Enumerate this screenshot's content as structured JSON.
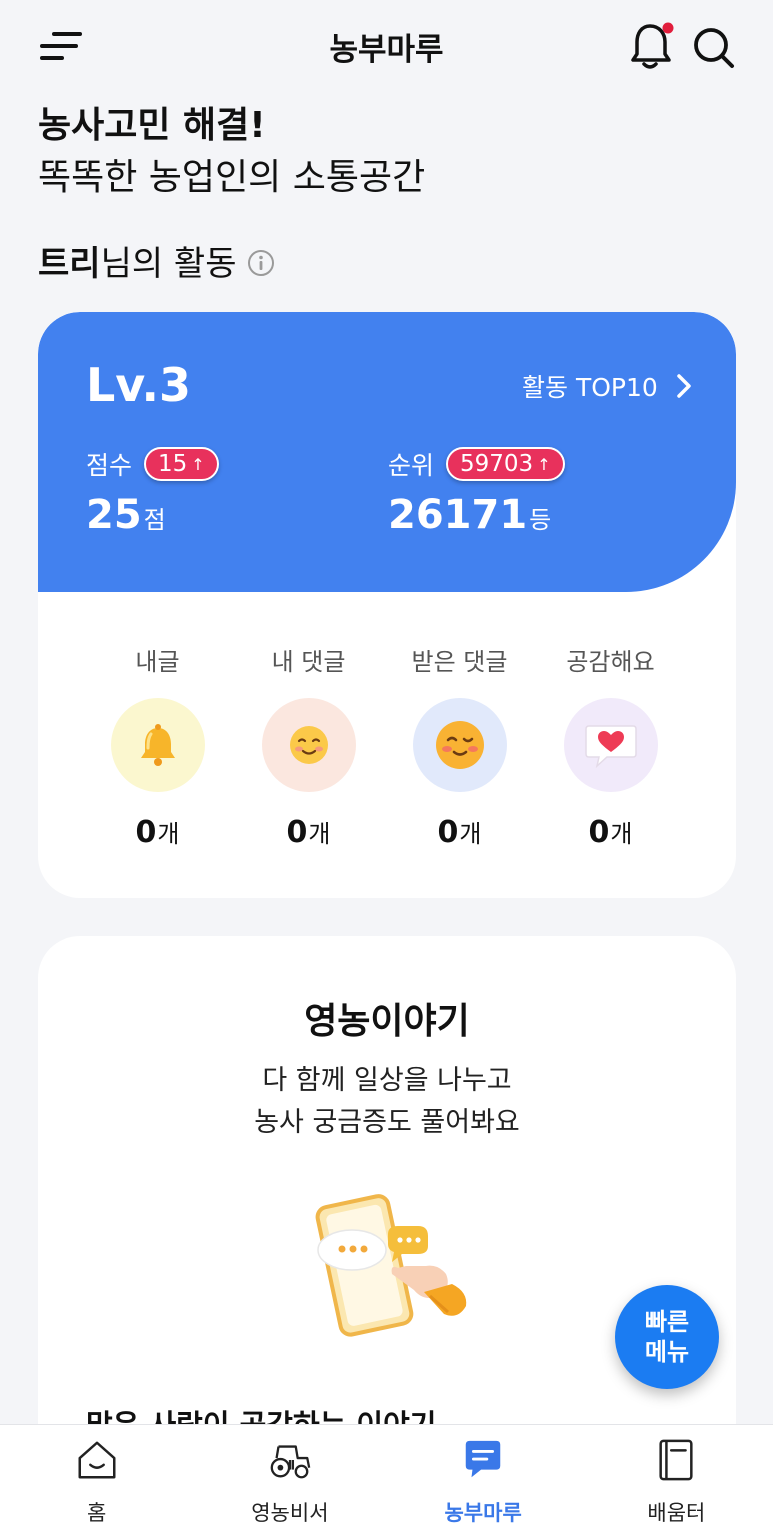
{
  "header": {
    "title": "농부마루",
    "menu_icon": "menu-icon",
    "bell_icon": "bell-icon",
    "search_icon": "search-icon",
    "has_notification": true
  },
  "intro": {
    "headline": "농사고민 해결!",
    "subline": "똑똑한 농업인의 소통공간"
  },
  "activity": {
    "user_name": "트리",
    "title_suffix": "님의 활동",
    "level": "Lv.3",
    "top10_label": "활동 TOP10",
    "score_label": "점수",
    "score_change": "15",
    "score_value": "25",
    "score_unit": "점",
    "rank_label": "순위",
    "rank_change": "59703",
    "rank_value": "26171",
    "rank_unit": "등",
    "stats": [
      {
        "label": "내글",
        "count": "0",
        "unit": "개",
        "icon": "bell-emoji-icon"
      },
      {
        "label": "내 댓글",
        "count": "0",
        "unit": "개",
        "icon": "smile-emoji-icon"
      },
      {
        "label": "받은 댓글",
        "count": "0",
        "unit": "개",
        "icon": "wink-emoji-icon"
      },
      {
        "label": "공감해요",
        "count": "0",
        "unit": "개",
        "icon": "heart-bubble-icon"
      }
    ]
  },
  "story": {
    "title": "영농이야기",
    "desc_line1": "다 함께 일상을 나누고",
    "desc_line2": "농사 궁금증도 풀어봐요",
    "popular_title": "많은 사람이 공감하는 이야기"
  },
  "fab": {
    "line1": "빠른",
    "line2": "메뉴"
  },
  "nav": {
    "items": [
      {
        "label": "홈",
        "icon": "home-icon"
      },
      {
        "label": "영농비서",
        "icon": "tractor-icon"
      },
      {
        "label": "농부마루",
        "icon": "chat-icon"
      },
      {
        "label": "배움터",
        "icon": "book-icon"
      }
    ],
    "active_index": 2
  },
  "colors": {
    "accent_blue": "#4281ef",
    "badge_red": "#e8315c",
    "fab_blue": "#1b7cf2",
    "nav_active": "#3a78e8"
  }
}
